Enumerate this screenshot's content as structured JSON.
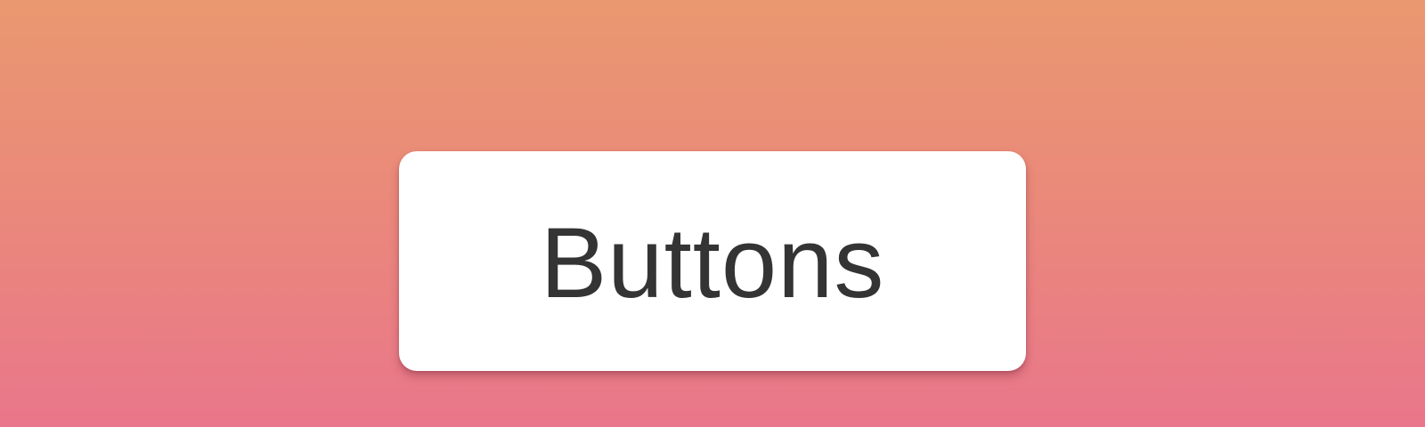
{
  "hero": {
    "button_label": "Buttons"
  },
  "colors": {
    "background_top": "#ea9870",
    "background_bottom": "#e9768a",
    "button_background": "#ffffff",
    "button_text": "#343434"
  }
}
